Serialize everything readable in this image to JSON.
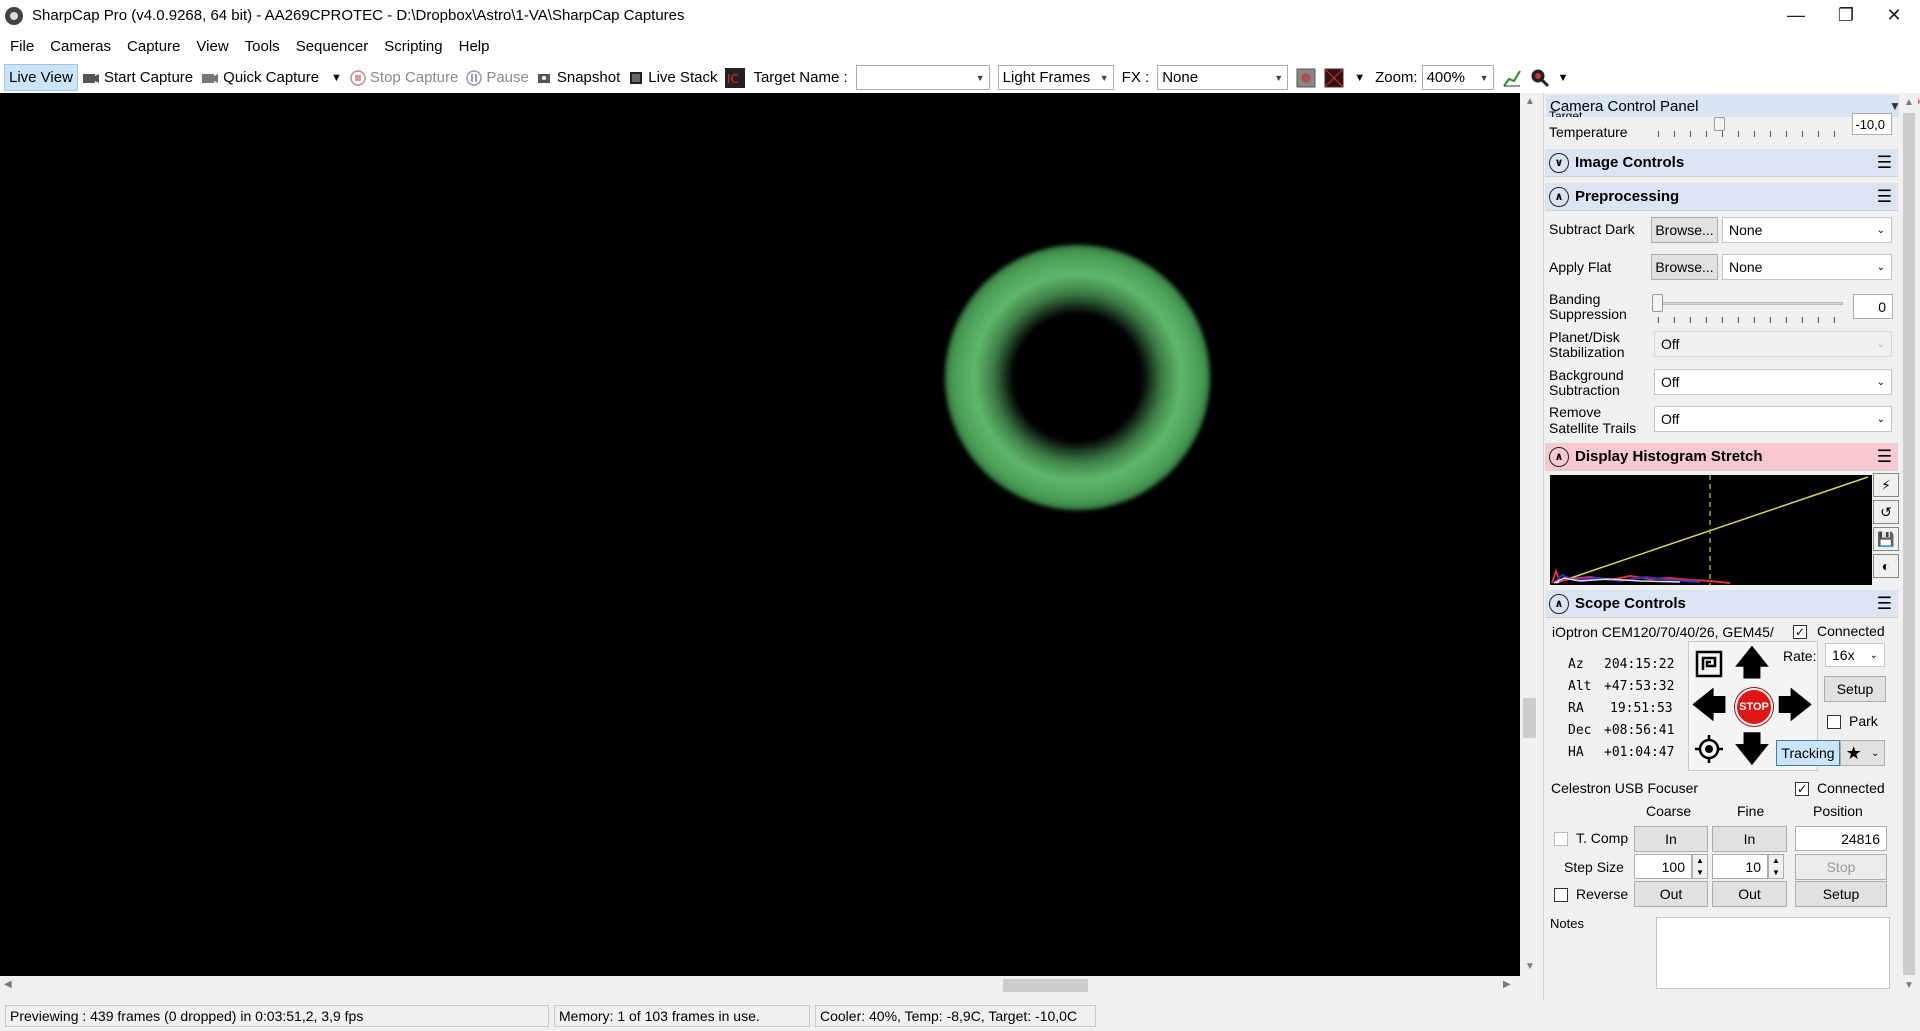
{
  "titlebar": {
    "title": "SharpCap Pro (v4.0.9268, 64 bit) - AA269CPROTEC - D:\\Dropbox\\Astro\\1-VA\\SharpCap Captures",
    "minimize_icon": "minimize-icon",
    "maximize_icon": "restore-icon",
    "close_icon": "close-icon"
  },
  "menu": [
    "File",
    "Cameras",
    "Capture",
    "View",
    "Tools",
    "Sequencer",
    "Scripting",
    "Help"
  ],
  "toolbar": {
    "live_view": "Live View",
    "start_capture": "Start Capture",
    "quick_capture": "Quick Capture",
    "stop_capture": "Stop Capture",
    "pause": "Pause",
    "snapshot": "Snapshot",
    "live_stack": "Live Stack",
    "target_name_label": "Target Name :",
    "target_name_value": "",
    "frame_type": "Light Frames",
    "fx_label": "FX :",
    "fx_value": "None",
    "zoom_label": "Zoom:",
    "zoom_value": "400%"
  },
  "statusbar": {
    "preview": "Previewing : 439 frames (0 dropped) in 0:03:51,2, 3,9 fps",
    "memory": "Memory: 1 of 103 frames in use.",
    "cooler": "Cooler: 40%, Temp: -8,9C, Target: -10,0C"
  },
  "panel": {
    "title": "Camera Control Panel",
    "target_temp_label_top": "Target",
    "target_temp_label": "Temperature",
    "target_temp_value": "-10,0",
    "image_controls": "Image Controls",
    "preprocessing": "Preprocessing",
    "subtract_dark_label": "Subtract Dark",
    "apply_flat_label": "Apply Flat",
    "browse": "Browse...",
    "subtract_dark_value": "None",
    "apply_flat_value": "None",
    "banding_label_1": "Banding",
    "banding_label_2": "Suppression",
    "banding_value": "0",
    "planet_label_1": "Planet/Disk",
    "planet_label_2": "Stabilization",
    "planet_value": "Off",
    "background_label_1": "Background",
    "background_label_2": "Subtraction",
    "background_value": "Off",
    "satellite_label_1": "Remove",
    "satellite_label_2": "Satellite Trails",
    "satellite_value": "Off",
    "histogram": "Display Histogram Stretch",
    "scope_controls": "Scope Controls",
    "mount_name": "iOptron CEM120/70/40/26, GEM45/",
    "connected": "Connected",
    "coords": [
      {
        "label": "Az",
        "value": "204:15:22"
      },
      {
        "label": "Alt",
        "value": "+47:53:32"
      },
      {
        "label": "RA",
        "value": "19:51:53"
      },
      {
        "label": "Dec",
        "value": "+08:56:41"
      },
      {
        "label": "HA",
        "value": "+01:04:47"
      }
    ],
    "rate_label": "Rate:",
    "rate_value": "16x",
    "setup": "Setup",
    "park": "Park",
    "tracking": "Tracking",
    "stop": "STOP",
    "focuser_name": "Celestron USB Focuser",
    "coarse": "Coarse",
    "fine": "Fine",
    "position": "Position",
    "tcomp": "T. Comp",
    "in": "In",
    "out": "Out",
    "position_value": "24816",
    "step_size_label": "Step Size",
    "step_coarse": "100",
    "step_fine": "10",
    "stop_btn": "Stop",
    "reverse": "Reverse",
    "notes_label": "Notes"
  }
}
